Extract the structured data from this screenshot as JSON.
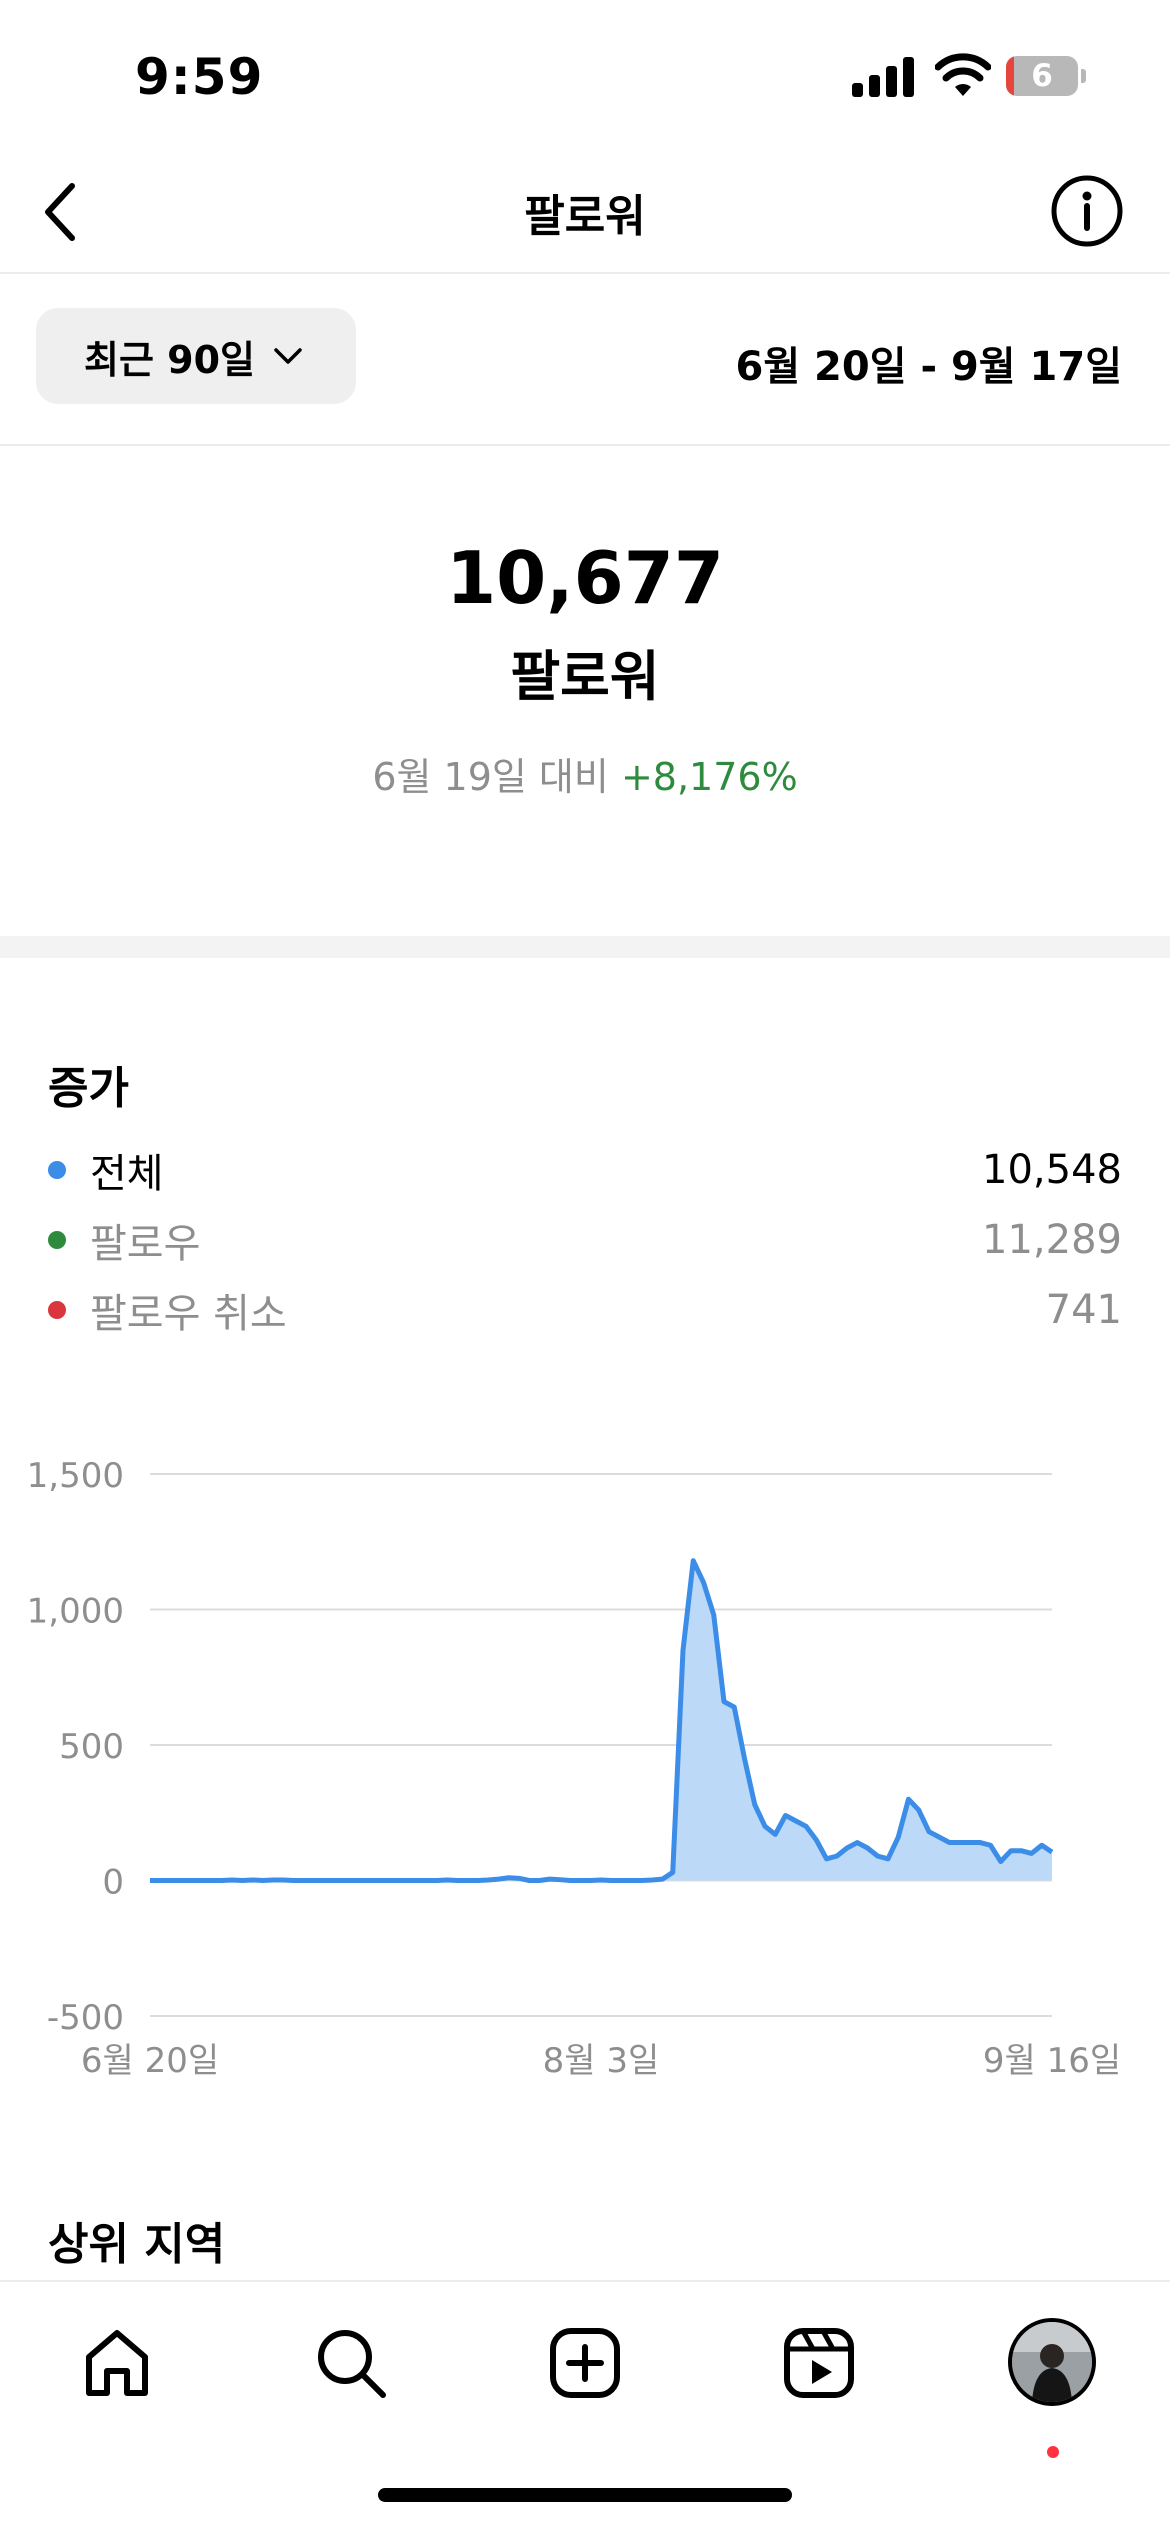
{
  "status_bar": {
    "time": "9:59",
    "battery_level": "6"
  },
  "header": {
    "title": "팔로워"
  },
  "range": {
    "selector_label": "최근 90일",
    "date_range": "6월 20일 - 9월 17일"
  },
  "summary": {
    "count": "10,677",
    "label": "팔로워",
    "compare_prefix": "6월 19일 대비",
    "compare_change": "+8,176%"
  },
  "growth": {
    "title": "증가",
    "legend": [
      {
        "name": "전체",
        "value": "10,548",
        "color": "#3b8de8"
      },
      {
        "name": "팔로우",
        "value": "11,289",
        "color": "#2e8b3e"
      },
      {
        "name": "팔로우 취소",
        "value": "741",
        "color": "#d9363e"
      }
    ]
  },
  "chart_data": {
    "type": "area",
    "ylim": [
      -500,
      1500
    ],
    "yticks": [
      "1,500",
      "1,000",
      "500",
      "0",
      "-500"
    ],
    "ytick_values": [
      1500,
      1000,
      500,
      0,
      -500
    ],
    "xtick_labels": [
      "6월 20일",
      "8월 3일",
      "9월 16일"
    ],
    "xtick_index": [
      0,
      44,
      88
    ],
    "series": [
      {
        "values": [
          0,
          0,
          0,
          0,
          0,
          0,
          0,
          0,
          2,
          0,
          2,
          0,
          2,
          2,
          0,
          0,
          0,
          0,
          0,
          0,
          0,
          0,
          0,
          0,
          0,
          0,
          0,
          0,
          0,
          2,
          0,
          0,
          0,
          2,
          5,
          10,
          8,
          0,
          0,
          5,
          3,
          0,
          0,
          0,
          2,
          0,
          0,
          0,
          0,
          2,
          5,
          30,
          850,
          1180,
          1100,
          980,
          660,
          640,
          450,
          280,
          200,
          170,
          240,
          220,
          200,
          150,
          80,
          90,
          120,
          140,
          120,
          90,
          80,
          160,
          300,
          260,
          180,
          160,
          140,
          140,
          140,
          140,
          130,
          70,
          110,
          110,
          100,
          130,
          105
        ]
      }
    ],
    "color": "#3b8de8",
    "fill": "#bcd9f7"
  },
  "regions": {
    "title": "상위 지역"
  },
  "tab_bar": {
    "items": [
      "home",
      "search",
      "create",
      "reels",
      "profile"
    ]
  }
}
